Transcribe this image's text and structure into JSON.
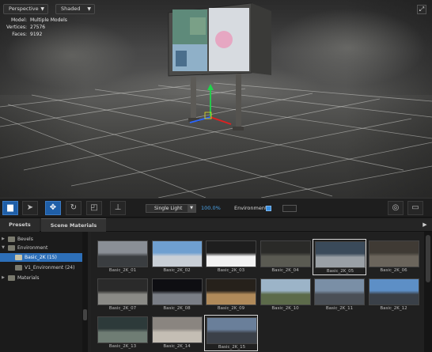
{
  "viewport": {
    "view_mode": "Perspective",
    "shading_mode": "Shaded",
    "stats": [
      {
        "key": "Model:",
        "value": "Multiple Models"
      },
      {
        "key": "Vertices:",
        "value": "27576"
      },
      {
        "key": "Faces:",
        "value": "9192"
      }
    ],
    "maximize_icon": "maximize-icon"
  },
  "toolbar": {
    "tools": [
      {
        "name": "camera-tool-button",
        "icon": "camera-icon",
        "glyph": "▆",
        "active": true
      },
      {
        "name": "select-tool-button",
        "icon": "cursor-icon",
        "glyph": "➤",
        "active": false
      },
      {
        "name": "move-tool-button",
        "icon": "move-icon",
        "glyph": "✥",
        "active": true
      },
      {
        "name": "rotate-tool-button",
        "icon": "rotate-icon",
        "glyph": "↻",
        "active": false
      },
      {
        "name": "scale-tool-button",
        "icon": "scale-icon",
        "glyph": "◰",
        "active": false
      },
      {
        "name": "transform-tool-button",
        "icon": "axis-icon",
        "glyph": "⊥",
        "active": false
      }
    ],
    "light_mode": "Single Light",
    "light_percent": "100.0%",
    "environment_label": "Environment",
    "environment_enabled": true,
    "right_buttons": [
      {
        "name": "target-button",
        "icon": "target-icon",
        "glyph": "◎"
      },
      {
        "name": "display-button",
        "icon": "monitor-icon",
        "glyph": "▭"
      }
    ]
  },
  "panel": {
    "tabs": [
      {
        "label": "Presets",
        "active": false
      },
      {
        "label": "Scene Materials",
        "active": true
      }
    ],
    "menu_icon": "menu-arrow-icon",
    "tree": [
      {
        "label": "Bevels",
        "level": 0,
        "expanded": false,
        "selected": false
      },
      {
        "label": "Environment",
        "level": 0,
        "expanded": true,
        "selected": false
      },
      {
        "label": "Basic_2K (15)",
        "level": 1,
        "expanded": false,
        "selected": true
      },
      {
        "label": "V1_Environment (24)",
        "level": 1,
        "expanded": false,
        "selected": false
      },
      {
        "label": "Materials",
        "level": 0,
        "expanded": false,
        "selected": false
      }
    ],
    "thumbnails": [
      {
        "label": "Basic_2K_01",
        "selected": false,
        "sky": "#8a8f96",
        "ground": "#3a3d40"
      },
      {
        "label": "Basic_2K_02",
        "selected": false,
        "sky": "#6f9fd0",
        "ground": "#c9cfd6"
      },
      {
        "label": "Basic_2K_03",
        "selected": false,
        "sky": "#1e1e1e",
        "ground": "#f2f2f2"
      },
      {
        "label": "Basic_2K_04",
        "selected": false,
        "sky": "#2a2a28",
        "ground": "#5a5a52"
      },
      {
        "label": "Basic_2K_05",
        "selected": true,
        "sky": "#3a4a5a",
        "ground": "#9aa0a6"
      },
      {
        "label": "Basic_2K_06",
        "selected": false,
        "sky": "#3f3a34",
        "ground": "#6b655c"
      },
      {
        "label": "Basic_2K_07",
        "selected": false,
        "sky": "#2a2a2a",
        "ground": "#8a8a86"
      },
      {
        "label": "Basic_2K_08",
        "selected": false,
        "sky": "#0e0e12",
        "ground": "#7a7e86"
      },
      {
        "label": "Basic_2K_09",
        "selected": false,
        "sky": "#26211b",
        "ground": "#b08a5a"
      },
      {
        "label": "Basic_2K_10",
        "selected": false,
        "sky": "#9cb4c8",
        "ground": "#5c6a4a"
      },
      {
        "label": "Basic_2K_11",
        "selected": false,
        "sky": "#7a8fa6",
        "ground": "#4a4f56"
      },
      {
        "label": "Basic_2K_12",
        "selected": false,
        "sky": "#5d8fc6",
        "ground": "#3a4048"
      },
      {
        "label": "Basic_2K_13",
        "selected": false,
        "sky": "#2d3a3a",
        "ground": "#6f7d74"
      },
      {
        "label": "Basic_2K_14",
        "selected": false,
        "sky": "#8a8580",
        "ground": "#c4beb4"
      },
      {
        "label": "Basic_2K_15",
        "selected": true,
        "sky": "#6a7f9a",
        "ground": "#3b4048"
      }
    ]
  }
}
